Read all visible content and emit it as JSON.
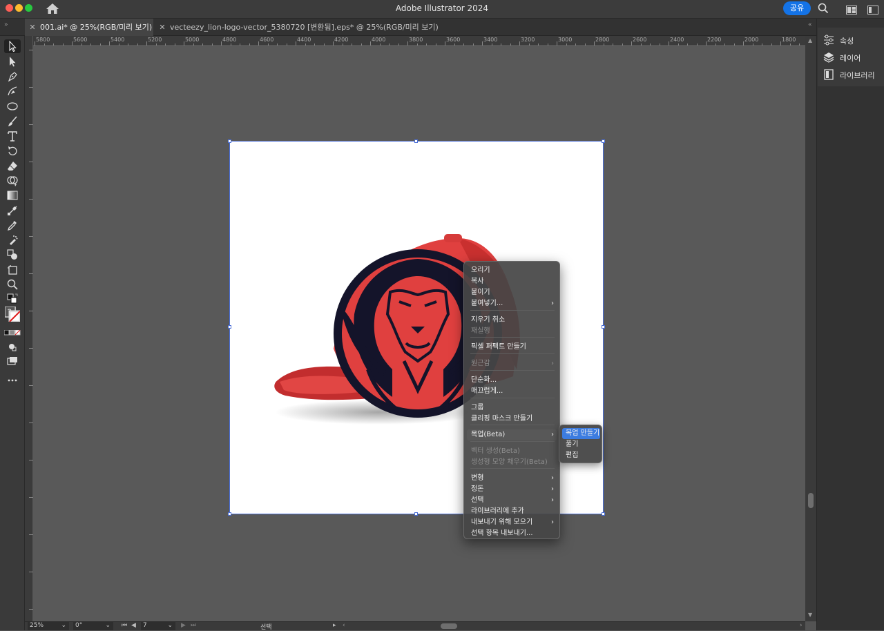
{
  "app": {
    "title": "Adobe Illustrator 2024",
    "share_label": "공유"
  },
  "tabs": [
    {
      "label": "001.ai* @ 25%(RGB/미리 보기)",
      "active": true
    },
    {
      "label": "vecteezy_lion-logo-vector_5380720 [변환됨].eps* @ 25%(RGB/미리 보기)",
      "active": false
    }
  ],
  "ruler": {
    "h_labels": [
      "5800",
      "5600",
      "5400",
      "5200",
      "5000",
      "4800",
      "4600",
      "4400",
      "4200",
      "4000",
      "3800",
      "3600",
      "3400",
      "3200",
      "3000",
      "2800",
      "2600",
      "2400",
      "2200",
      "2000",
      "1800"
    ]
  },
  "right_panel": {
    "items": [
      {
        "label": "속성",
        "icon": "properties-icon"
      },
      {
        "label": "레이어",
        "icon": "layers-icon"
      },
      {
        "label": "라이브러리",
        "icon": "libraries-icon"
      }
    ]
  },
  "context_menu": {
    "items": [
      {
        "label": "오리기",
        "disabled": false,
        "submenu": false
      },
      {
        "label": "복사",
        "disabled": false,
        "submenu": false
      },
      {
        "label": "붙이기",
        "disabled": false,
        "submenu": false
      },
      {
        "label": "붙여넣기...",
        "disabled": false,
        "submenu": true
      },
      {
        "label": "지우기 취소",
        "disabled": false,
        "submenu": false
      },
      {
        "label": "재실행",
        "disabled": true,
        "submenu": false
      },
      {
        "label": "픽셀 퍼펙트 만들기",
        "disabled": false,
        "submenu": false
      },
      {
        "label": "원근감",
        "disabled": true,
        "submenu": true
      },
      {
        "label": "단순화...",
        "disabled": false,
        "submenu": false
      },
      {
        "label": "매끄럽게...",
        "disabled": false,
        "submenu": false
      },
      {
        "label": "그룹",
        "disabled": false,
        "submenu": false
      },
      {
        "label": "클리핑 마스크 만들기",
        "disabled": false,
        "submenu": false
      },
      {
        "label": "목업(Beta)",
        "disabled": false,
        "submenu": true,
        "highlighted": true
      },
      {
        "label": "벡터 생성(Beta)",
        "disabled": true,
        "submenu": false
      },
      {
        "label": "생성형 모양 채우기(Beta)",
        "disabled": true,
        "submenu": false
      },
      {
        "label": "변형",
        "disabled": false,
        "submenu": true
      },
      {
        "label": "정돈",
        "disabled": false,
        "submenu": true
      },
      {
        "label": "선택",
        "disabled": false,
        "submenu": true
      },
      {
        "label": "라이브러리에 추가",
        "disabled": false,
        "submenu": false
      },
      {
        "label": "내보내기 위해 모으기",
        "disabled": false,
        "submenu": true
      },
      {
        "label": "선택 항목 내보내기...",
        "disabled": false,
        "submenu": false
      }
    ],
    "submenu_items": [
      {
        "label": "목업 만들기",
        "selected": true
      },
      {
        "label": "풀기",
        "selected": false
      },
      {
        "label": "편집",
        "selected": false
      }
    ]
  },
  "status": {
    "zoom": "25%",
    "rotation": "0°",
    "artboard_number": "7",
    "mode": "선택"
  },
  "colors": {
    "accent": "#1473e6",
    "selection": "#4a6ed6",
    "menu_highlight": "#3c7ce0",
    "cap_red": "#e0403f",
    "logo_navy": "#14142a"
  }
}
